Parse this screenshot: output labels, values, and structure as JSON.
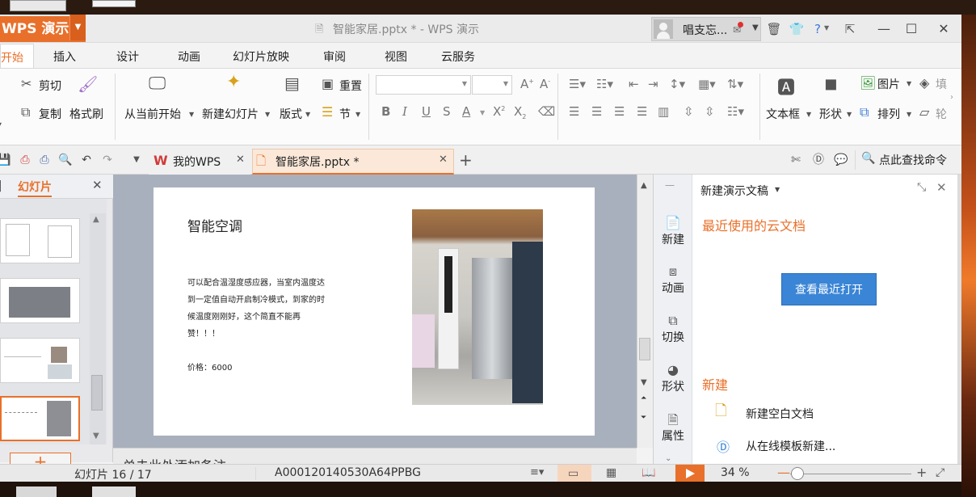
{
  "window": {
    "app_button": "WPS 演示",
    "doc_title": "智能家居.pptx * - WPS 演示",
    "user_name": "唱支忘..."
  },
  "menu": {
    "tabs": [
      "开始",
      "插入",
      "设计",
      "动画",
      "幻灯片放映",
      "审阅",
      "视图",
      "云服务"
    ]
  },
  "ribbon": {
    "cut": "剪切",
    "copy": "复制",
    "format_painter": "格式刷",
    "from_current": "从当前开始",
    "new_slide": "新建幻灯片",
    "layout": "版式",
    "reset": "重置",
    "section": "节",
    "textbox": "文本框",
    "shape": "形状",
    "picture": "图片",
    "arrange": "排列",
    "fill": "填",
    "outline": "轮"
  },
  "tabbar": {
    "tab_mywps": "我的WPS",
    "tab_doc": "智能家居.pptx *",
    "search_placeholder": "点此查找命令"
  },
  "leftpanel": {
    "title": "幻灯片"
  },
  "slide": {
    "heading": "智能空调",
    "body": "可以配合温湿度感应器，当室内温度达到一定值自动开启制冷模式，到家的时候温度刚刚好，这个简直不能再赞！！！",
    "price": "价格：6000"
  },
  "notes": {
    "placeholder": "单击此处添加备注"
  },
  "taskpane": {
    "title": "新建演示文稿",
    "side_items": [
      "新建",
      "动画",
      "切换",
      "形状",
      "属性"
    ],
    "recent_heading": "最近使用的云文档",
    "open_recent_button": "查看最近打开",
    "new_heading": "新建",
    "new_blank": "新建空白文档",
    "new_from_template": "从在线模板新建..."
  },
  "statusbar": {
    "slide_counter": "幻灯片 16 / 17",
    "doc_id": "A000120140530A64PPBG",
    "zoom_percent": "34 %",
    "zoom_level": 0.34
  },
  "colors": {
    "accent": "#e8702a",
    "button_blue": "#3a85d6"
  }
}
